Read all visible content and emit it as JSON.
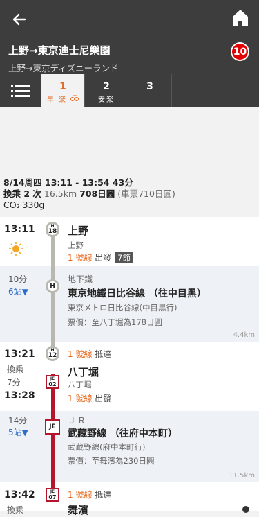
{
  "header": {
    "title": "上野→東京迪士尼樂園",
    "subtitle": "上野→東京ディズニーランド",
    "badge": "10"
  },
  "tabs": [
    {
      "num": "1",
      "sub": "早  楽 ",
      "active": true
    },
    {
      "num": "2",
      "sub": "安楽"
    },
    {
      "num": "3",
      "sub": ""
    }
  ],
  "summary": {
    "line1": "8/14周四 13:11 - 13:54 43分",
    "transfers": "換乘 2 次",
    "distance": "16.5km",
    "fare": "708日圓",
    "ticket": "(車票710日圓)",
    "co2": "CO₂ 330g"
  },
  "stops": {
    "ueno": {
      "time": "13:11",
      "name": "上野",
      "sub": "上野",
      "line": "1 號線",
      "action": "出發",
      "car": "7節",
      "code_a": "H",
      "code_b": "18"
    },
    "seg1": {
      "minutes": "10分",
      "stations": "6站▼",
      "mode": "地下鐵",
      "line": "東京地鐵日比谷線 （往中目黑）",
      "line_jp": "東京メトロ日比谷線(中目黒行)",
      "fare": "票價：至八丁堀為178日圓",
      "dist": "4.4km",
      "code": "H"
    },
    "hatchobori": {
      "time_arr": "13:21",
      "transfer": "換乘",
      "wait": "7分",
      "time_dep": "13:28",
      "arr_line": "1 號線",
      "arr_action": "抵達",
      "name": "八丁堀",
      "sub": "八丁堀",
      "dep_line": "1 號線",
      "dep_action": "出發",
      "code1_a": "H",
      "code1_b": "12",
      "code2_a": "JE",
      "code2_b": "02"
    },
    "seg2": {
      "minutes": "14分",
      "stations": "5站▼",
      "mode": "ＪＲ",
      "line": "武藏野線 （往府中本町）",
      "line_jp": "武蔵野線(府中本町行)",
      "fare": "票價：至舞濱為230日圓",
      "dist": "11.5km",
      "code": "JE"
    },
    "maihama": {
      "time": "13:42",
      "transfer": "換乘",
      "line": "1 號線",
      "action": "抵達",
      "name": "舞濱",
      "code_a": "JE",
      "code_b": "07"
    }
  }
}
